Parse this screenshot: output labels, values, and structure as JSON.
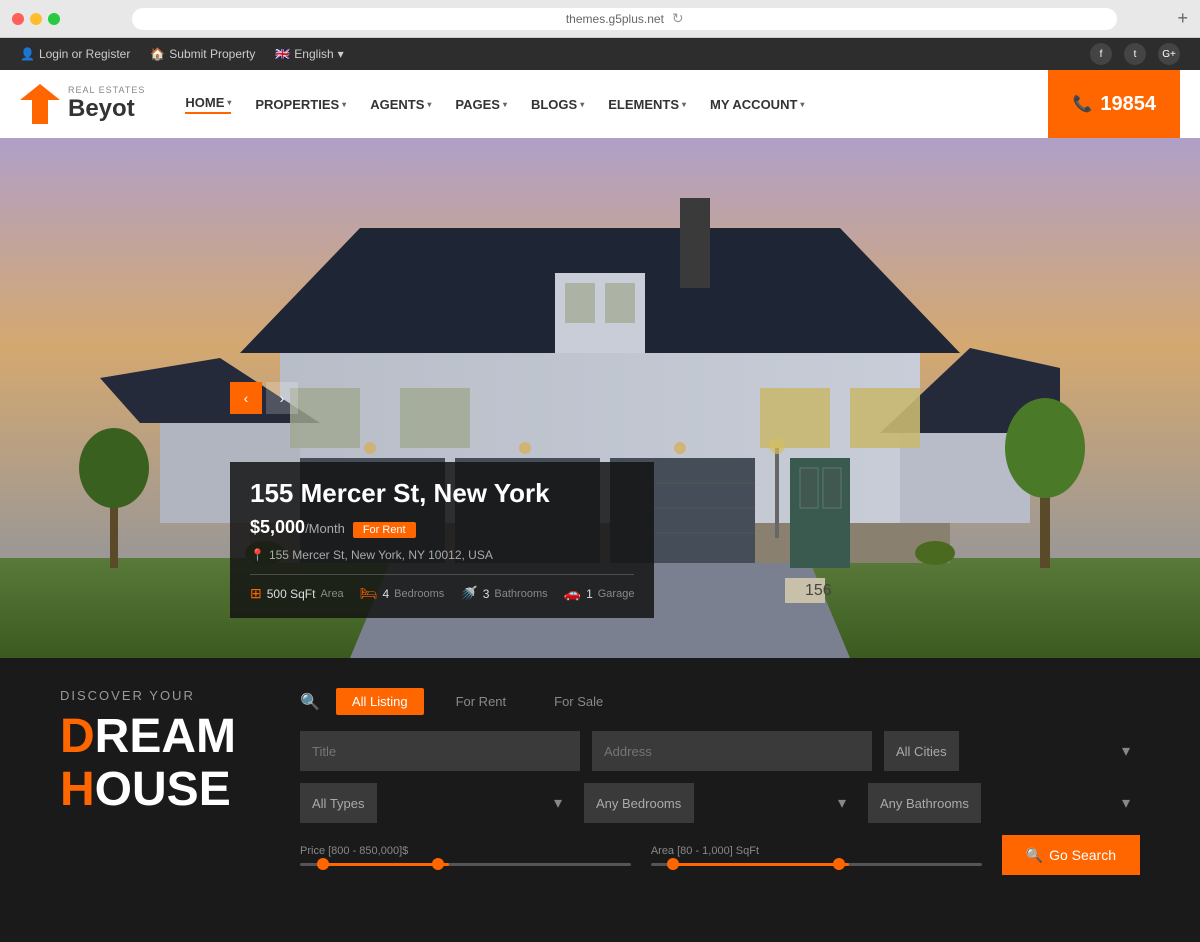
{
  "browser": {
    "url": "themes.g5plus.net",
    "plus_label": "+"
  },
  "topbar": {
    "login_label": "Login or Register",
    "submit_label": "Submit Property",
    "language_label": "English",
    "social": [
      "f",
      "t",
      "G+"
    ]
  },
  "header": {
    "logo_small": "REAL ESTATES",
    "logo_big": "Beyot",
    "phone": "19854",
    "nav_items": [
      {
        "label": "HOME",
        "active": true
      },
      {
        "label": "PROPERTIES"
      },
      {
        "label": "AGENTS"
      },
      {
        "label": "PAGES"
      },
      {
        "label": "BLOGS"
      },
      {
        "label": "ELEMENTS"
      },
      {
        "label": "MY ACCOUNT"
      }
    ]
  },
  "hero": {
    "property_title": "155 Mercer St, New York",
    "price": "$5,000",
    "price_period": "/Month",
    "badge": "For Rent",
    "address": "155 Mercer St, New York, NY 10012, USA",
    "features": [
      {
        "icon": "⊞",
        "value": "500 SqFt",
        "label": "Area"
      },
      {
        "icon": "🛏",
        "value": "4",
        "label": "Bedrooms"
      },
      {
        "icon": "🚿",
        "value": "3",
        "label": "Bathrooms"
      },
      {
        "icon": "🚗",
        "value": "1",
        "label": "Garage"
      }
    ]
  },
  "search": {
    "discover_sub": "DISCOVER YOUR",
    "discover_line1_prefix": "D",
    "discover_line1_rest": "REAM",
    "discover_line2_prefix": "H",
    "discover_line2_rest": "OUSE",
    "tabs": [
      "All Listing",
      "For Rent",
      "For Sale"
    ],
    "active_tab": "All Listing",
    "inputs": {
      "title_placeholder": "Title",
      "address_placeholder": "Address"
    },
    "selects": {
      "cities": "All Cities",
      "types": "All Types",
      "bedrooms": "Any Bedrooms",
      "bathrooms": "Any Bathrooms"
    },
    "price_label": "Price [800 - 850,000]$",
    "area_label": "Area [80 - 1,000] SqFt",
    "search_btn": "Go Search",
    "price_fill_percent": 40,
    "area_fill_percent": 55,
    "price_thumb_left": "38%",
    "area_thumb_left": "53%"
  },
  "colors": {
    "orange": "#ff6600",
    "dark_bg": "#1a1a1a",
    "topbar_bg": "#2d2d2d"
  }
}
